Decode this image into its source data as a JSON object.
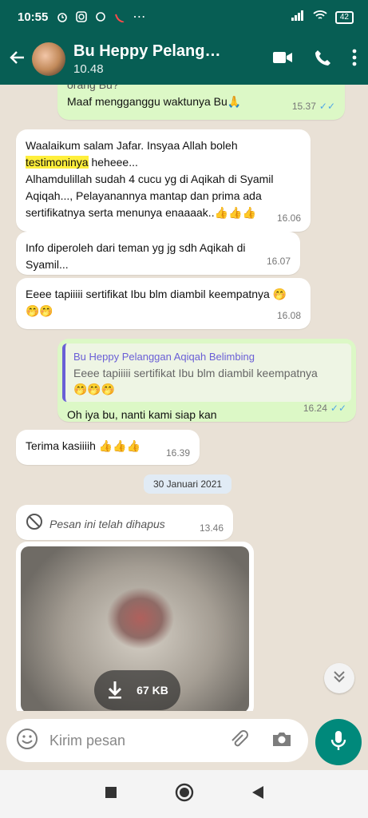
{
  "status": {
    "time": "10:55",
    "battery": "42"
  },
  "header": {
    "contact_name": "Bu Heppy Pelang…",
    "subtitle": "10.48"
  },
  "messages": [
    {
      "dir": "out",
      "lines": [
        "orang Bu?",
        "Maaf mengganggu waktunya Bu🙏"
      ],
      "time": "15.37"
    },
    {
      "dir": "in",
      "line1": "Waalaikum salam Jafar. Insyaa Allah boleh",
      "highlight": "testimoninya",
      "line2_rest": " heheee...",
      "line3": "Alhamdulillah sudah 4 cucu yg di Aqikah di Syamil",
      "line4": "Aqiqah..., Pelayanannya mantap dan prima ada",
      "line5": "sertifikatnya serta menunya enaaaak..👍👍👍",
      "time": "16.06"
    },
    {
      "dir": "in",
      "text": "Info diperoleh dari teman yg jg sdh Aqikah di Syamil...",
      "time": "16.07"
    },
    {
      "dir": "in",
      "line1": "Eeee tapiiiii sertifikat Ibu blm diambil keempatnya 🤭",
      "line2": "🤭🤭",
      "time": "16.08"
    },
    {
      "dir": "out",
      "quote_name": "Bu Heppy Pelanggan Aqiqah Belimbing",
      "quote_line1": "Eeee tapiiiii sertifikat Ibu blm diambil keempatnya",
      "quote_line2": "🤭🤭🤭",
      "text": "Oh iya bu, nanti kami siap kan",
      "time": "16.24"
    },
    {
      "dir": "in",
      "text": "Terima kasiiiih 👍👍👍",
      "time": "16.39"
    },
    {
      "dir": "in",
      "deleted_text": "Pesan ini telah dihapus",
      "time": "13.46"
    }
  ],
  "date_divider": "30 Januari 2021",
  "media": {
    "size": "67 KB"
  },
  "composer": {
    "placeholder": "Kirim pesan"
  },
  "icons": {
    "back": "arrow-left-icon",
    "video": "video-call-icon",
    "call": "phone-icon",
    "menu": "more-vert-icon",
    "emoji": "emoji-icon",
    "attach": "paperclip-icon",
    "camera": "camera-icon",
    "mic": "microphone-icon",
    "deleted": "blocked-icon",
    "download": "download-icon",
    "scroll": "chevron-double-down-icon"
  },
  "colors": {
    "header": "#075e54",
    "outgoing": "#dcf8c6",
    "incoming": "#ffffff",
    "ticks": "#4fa6e6",
    "mic": "#00897b"
  }
}
